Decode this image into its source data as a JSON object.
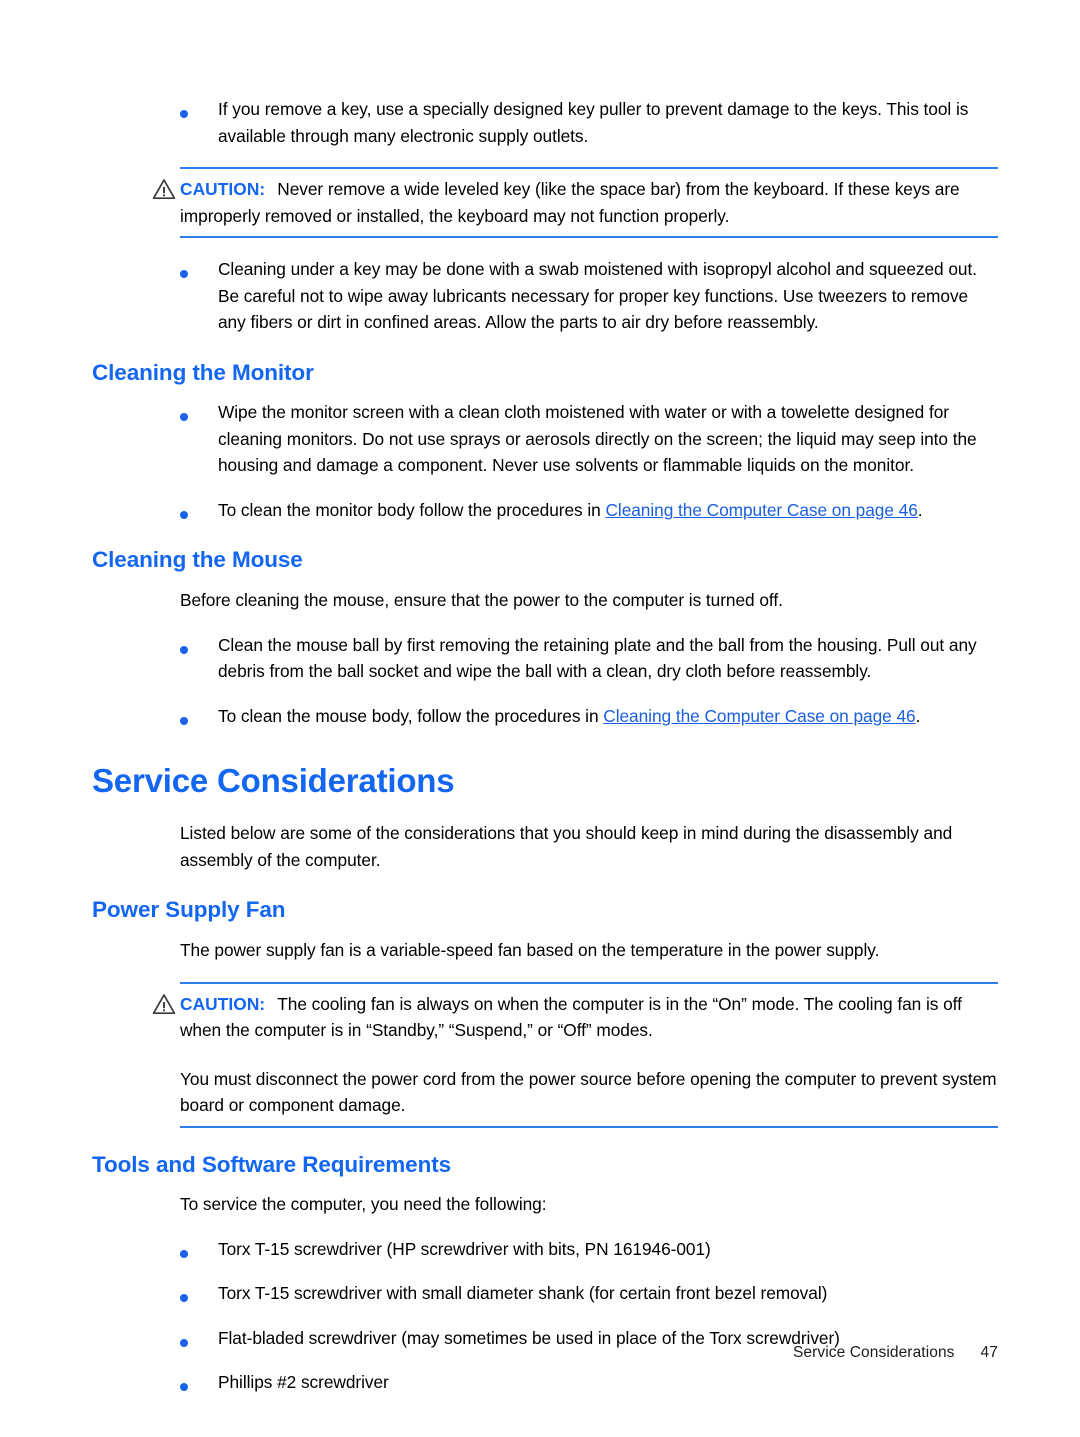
{
  "document": {
    "type": "service-manual-page",
    "colors": {
      "heading_blue": "#1366f0",
      "bullet_blue": "#1a62e8",
      "rule_blue": "#2f7fe8",
      "link_blue": "#1a5fe0",
      "body_text": "#000000",
      "page_background": "#ffffff"
    }
  },
  "blocks": {
    "bullet_key_puller": "If you remove a key, use a specially designed key puller to prevent damage to the keys. This tool is available through many electronic supply outlets.",
    "caution_1": {
      "icon": "warning-triangle-icon",
      "label": "CAUTION:",
      "text": "Never remove a wide leveled key (like the space bar) from the keyboard. If these keys are improperly removed or installed, the keyboard may not function properly."
    },
    "bullet_cleaning_under_key": "Cleaning under a key may be done with a swab moistened with isopropyl alcohol and squeezed out. Be careful not to wipe away lubricants necessary for proper key functions. Use tweezers to remove any fibers or dirt in confined areas. Allow the parts to air dry before reassembly.",
    "heading_cleaning_monitor": "Cleaning the Monitor",
    "bullet_wipe_monitor": "Wipe the monitor screen with a clean cloth moistened with water or with a towelette designed for cleaning monitors. Do not use sprays or aerosols directly on the screen; the liquid may seep into the housing and damage a component. Never use solvents or flammable liquids on the monitor.",
    "bullet_monitor_body": {
      "before": "To clean the monitor body follow the procedures in ",
      "link": "Cleaning the Computer Case on page 46",
      "after": "."
    },
    "heading_cleaning_mouse": "Cleaning the Mouse",
    "para_before_mouse": "Before cleaning the mouse, ensure that the power to the computer is turned off.",
    "bullet_mouse_ball": "Clean the mouse ball by first removing the retaining plate and the ball from the housing. Pull out any debris from the ball socket and wipe the ball with a clean, dry cloth before reassembly.",
    "bullet_mouse_body": {
      "before": "To clean the mouse body, follow the procedures in ",
      "link": "Cleaning the Computer Case on page 46",
      "after": "."
    },
    "heading_service_considerations": "Service Considerations",
    "para_listed_below": "Listed below are some of the considerations that you should keep in mind during the disassembly and assembly of the computer.",
    "heading_power_supply_fan": "Power Supply Fan",
    "para_power_supply_fan": "The power supply fan is a variable-speed fan based on the temperature in the power supply.",
    "caution_2": {
      "icon": "warning-triangle-icon",
      "label": "CAUTION:",
      "text": "The cooling fan is always on when the computer is in the “On” mode. The cooling fan is off when the computer is in “Standby,” “Suspend,” or “Off” modes.",
      "extra": "You must disconnect the power cord from the power source before opening the computer to prevent system board or component damage."
    },
    "heading_tools_software": "Tools and Software Requirements",
    "para_to_service": "To service the computer, you need the following:",
    "tools_list": [
      "Torx T-15 screwdriver (HP screwdriver with bits, PN 161946-001)",
      "Torx T-15 screwdriver with small diameter shank (for certain front bezel removal)",
      "Flat-bladed screwdriver (may sometimes be used in place of the Torx screwdriver)",
      "Phillips #2 screwdriver"
    ]
  },
  "footer": {
    "section": "Service Considerations",
    "page_number": "47"
  }
}
